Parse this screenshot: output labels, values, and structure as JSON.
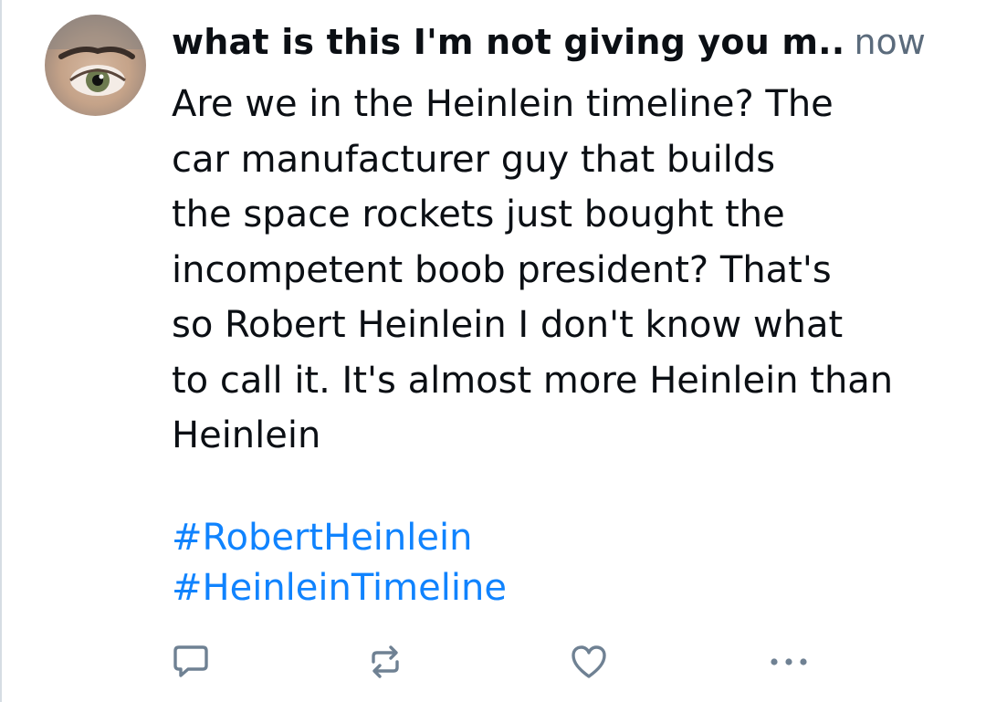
{
  "post": {
    "author": "what is this I'm not giving you m..",
    "time": "now",
    "text": "Are we in the Heinlein timeline? The\ncar manufacturer guy that builds\nthe space rockets just bought the\nincompetent boob president? That's\nso Robert Heinlein I don't know what\nto call it. It's almost more Heinlein than\nHeinlein",
    "hashtags": [
      "#RobertHeinlein",
      "#HeinleinTimeline"
    ]
  },
  "actions": {
    "reply_icon": "speech-bubble-icon",
    "repost_icon": "repost-arrows-icon",
    "like_icon": "heart-icon",
    "more_icon": "ellipsis-icon"
  },
  "colors": {
    "text": "#0b0f14",
    "muted": "#5b6b7c",
    "link": "#1083fe",
    "icon": "#6f8193"
  }
}
